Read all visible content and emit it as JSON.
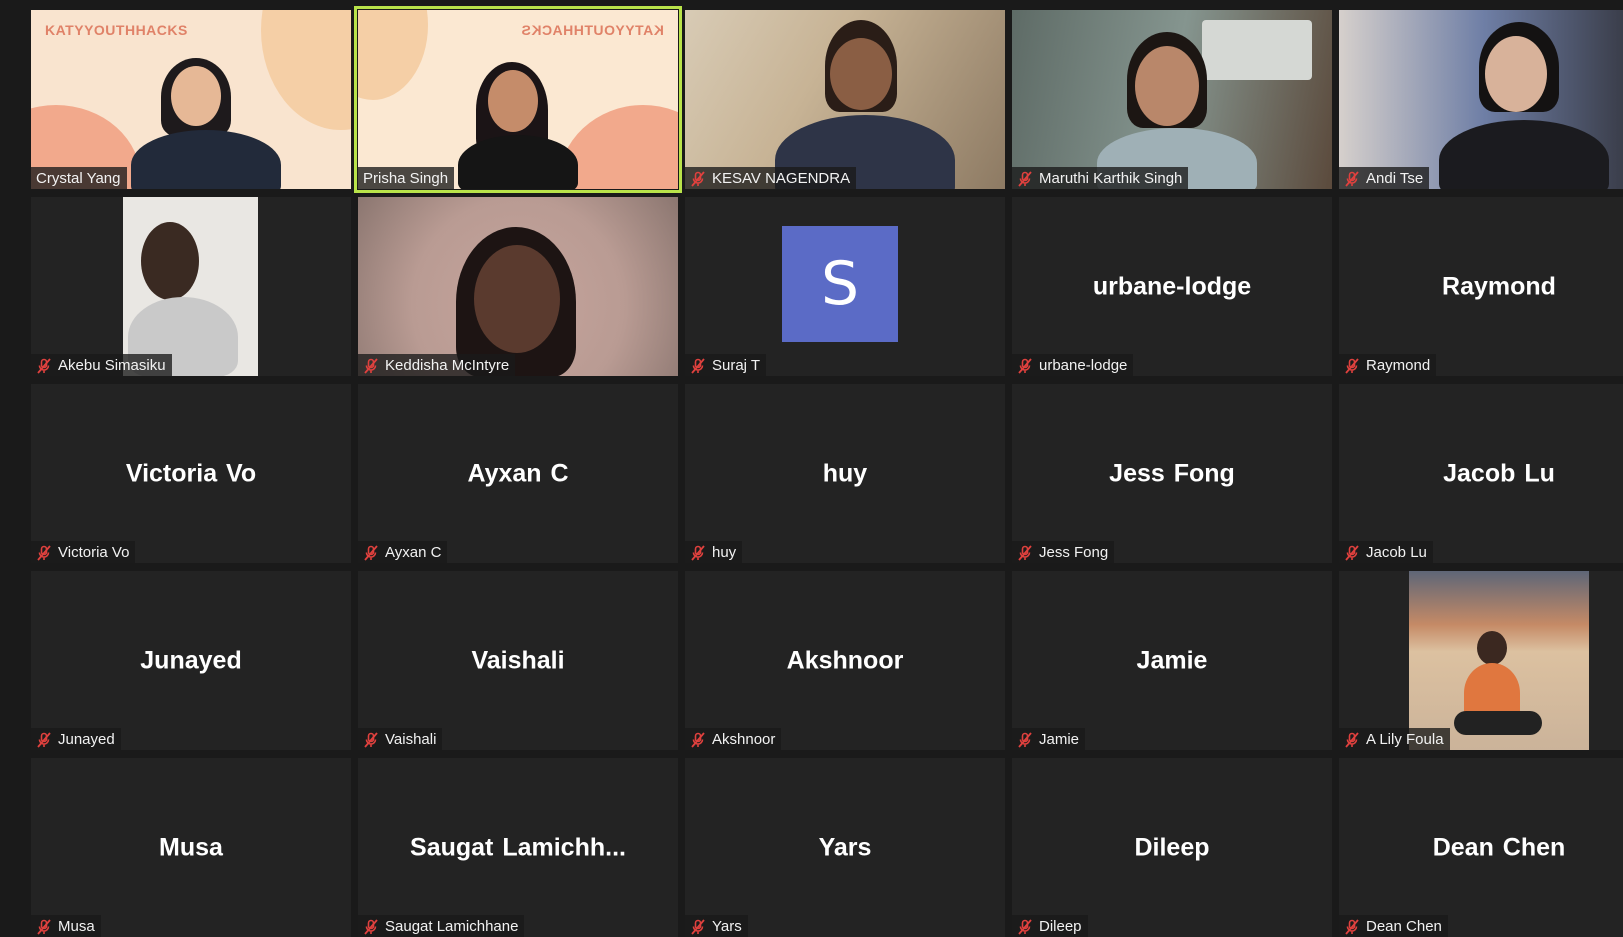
{
  "participants": [
    {
      "name": "Crystal Yang",
      "type": "video",
      "muted": false,
      "brand": "KATYYOUTHHACKS"
    },
    {
      "name": "Prisha Singh",
      "type": "video",
      "muted": false,
      "speaking": true,
      "brand": "KATYYOUTHHACKS"
    },
    {
      "name": "KESAV NAGENDRA",
      "type": "video",
      "muted": true
    },
    {
      "name": "Maruthi Karthik Singh",
      "type": "video",
      "muted": true
    },
    {
      "name": "Andi Tse",
      "type": "video",
      "muted": true
    },
    {
      "name": "Akebu Simasiku",
      "type": "portrait",
      "muted": true
    },
    {
      "name": "Keddisha McIntyre",
      "type": "video",
      "muted": true
    },
    {
      "name": "Suraj T",
      "type": "avatar",
      "initial": "S",
      "muted": true
    },
    {
      "name": "urbane-lodge",
      "display": "urbane-lodge",
      "type": "name",
      "muted": true
    },
    {
      "name": "Raymond",
      "display": "Raymond",
      "type": "name",
      "muted": true
    },
    {
      "name": "Victoria Vo",
      "display": "Victoria Vo",
      "type": "name",
      "muted": true
    },
    {
      "name": "Ayxan C",
      "display": "Ayxan C",
      "type": "name",
      "muted": true
    },
    {
      "name": "huy",
      "display": "huy",
      "type": "name",
      "muted": true
    },
    {
      "name": "Jess Fong",
      "display": "Jess Fong",
      "type": "name",
      "muted": true
    },
    {
      "name": "Jacob Lu",
      "display": "Jacob Lu",
      "type": "name",
      "muted": true
    },
    {
      "name": "Junayed",
      "display": "Junayed",
      "type": "name",
      "muted": true
    },
    {
      "name": "Vaishali",
      "display": "Vaishali",
      "type": "name",
      "muted": true
    },
    {
      "name": "Akshnoor",
      "display": "Akshnoor",
      "type": "name",
      "muted": true
    },
    {
      "name": "Jamie",
      "display": "Jamie",
      "type": "name",
      "muted": true
    },
    {
      "name": "A Lily Foula",
      "type": "portrait-sunset",
      "muted": true
    },
    {
      "name": "Musa",
      "display": "Musa",
      "type": "name",
      "muted": true
    },
    {
      "name": "Saugat Lamichhane",
      "display": "Saugat  Lamichh...",
      "type": "name",
      "muted": true
    },
    {
      "name": "Yars",
      "display": "Yars",
      "type": "name",
      "muted": true
    },
    {
      "name": "Dileep",
      "display": "Dileep",
      "type": "name",
      "muted": true
    },
    {
      "name": "Dean Chen",
      "display": "Dean Chen",
      "type": "name",
      "muted": true
    }
  ],
  "colors": {
    "background": "#1a1a1a",
    "tile": "#232323",
    "active_speaker_border": "#b9e34a",
    "muted_icon": "#e0413e",
    "avatar_bg": "#5b6bc6",
    "brand_text": "#e08268"
  },
  "icons": {
    "muted": "microphone-muted-icon"
  }
}
